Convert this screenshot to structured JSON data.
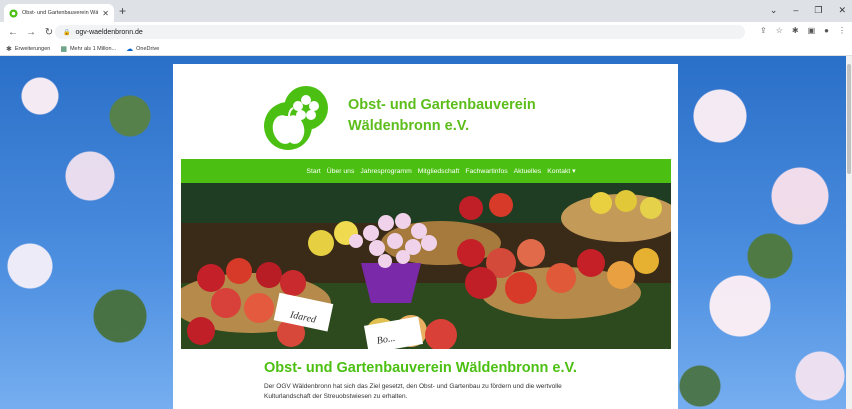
{
  "browser": {
    "tab_title": "Obst- und Gartenbauverein Wäl",
    "new_tab": "+",
    "url": "ogv-waeldenbronn.de",
    "bookmarks": [
      "Erweiterungen",
      "Mehr als 1 Millon...",
      "OneDrive"
    ]
  },
  "site": {
    "title_line1": "Obst- und Gartenbauverein",
    "title_line2": "Wäldenbronn e.V.",
    "nav": [
      "Start",
      "Über uns",
      "Jahresprogramm",
      "Mitgliedschaft",
      "Fachwartinfos",
      "Aktuelles",
      "Kontakt ▾"
    ],
    "hero_labels": [
      "Idared",
      "Bo..."
    ],
    "intro_title": "Obst- und Gartenbauverein Wäldenbronn e.V.",
    "intro_text": "Der OGV Wäldenbronn hat sich das Ziel gesetzt, den Obst- und Gartenbau zu fördern und die wertvolle Kulturlandschaft der Streuobstwiesen zu erhalten."
  },
  "colors": {
    "brand_green": "#4cc012"
  }
}
